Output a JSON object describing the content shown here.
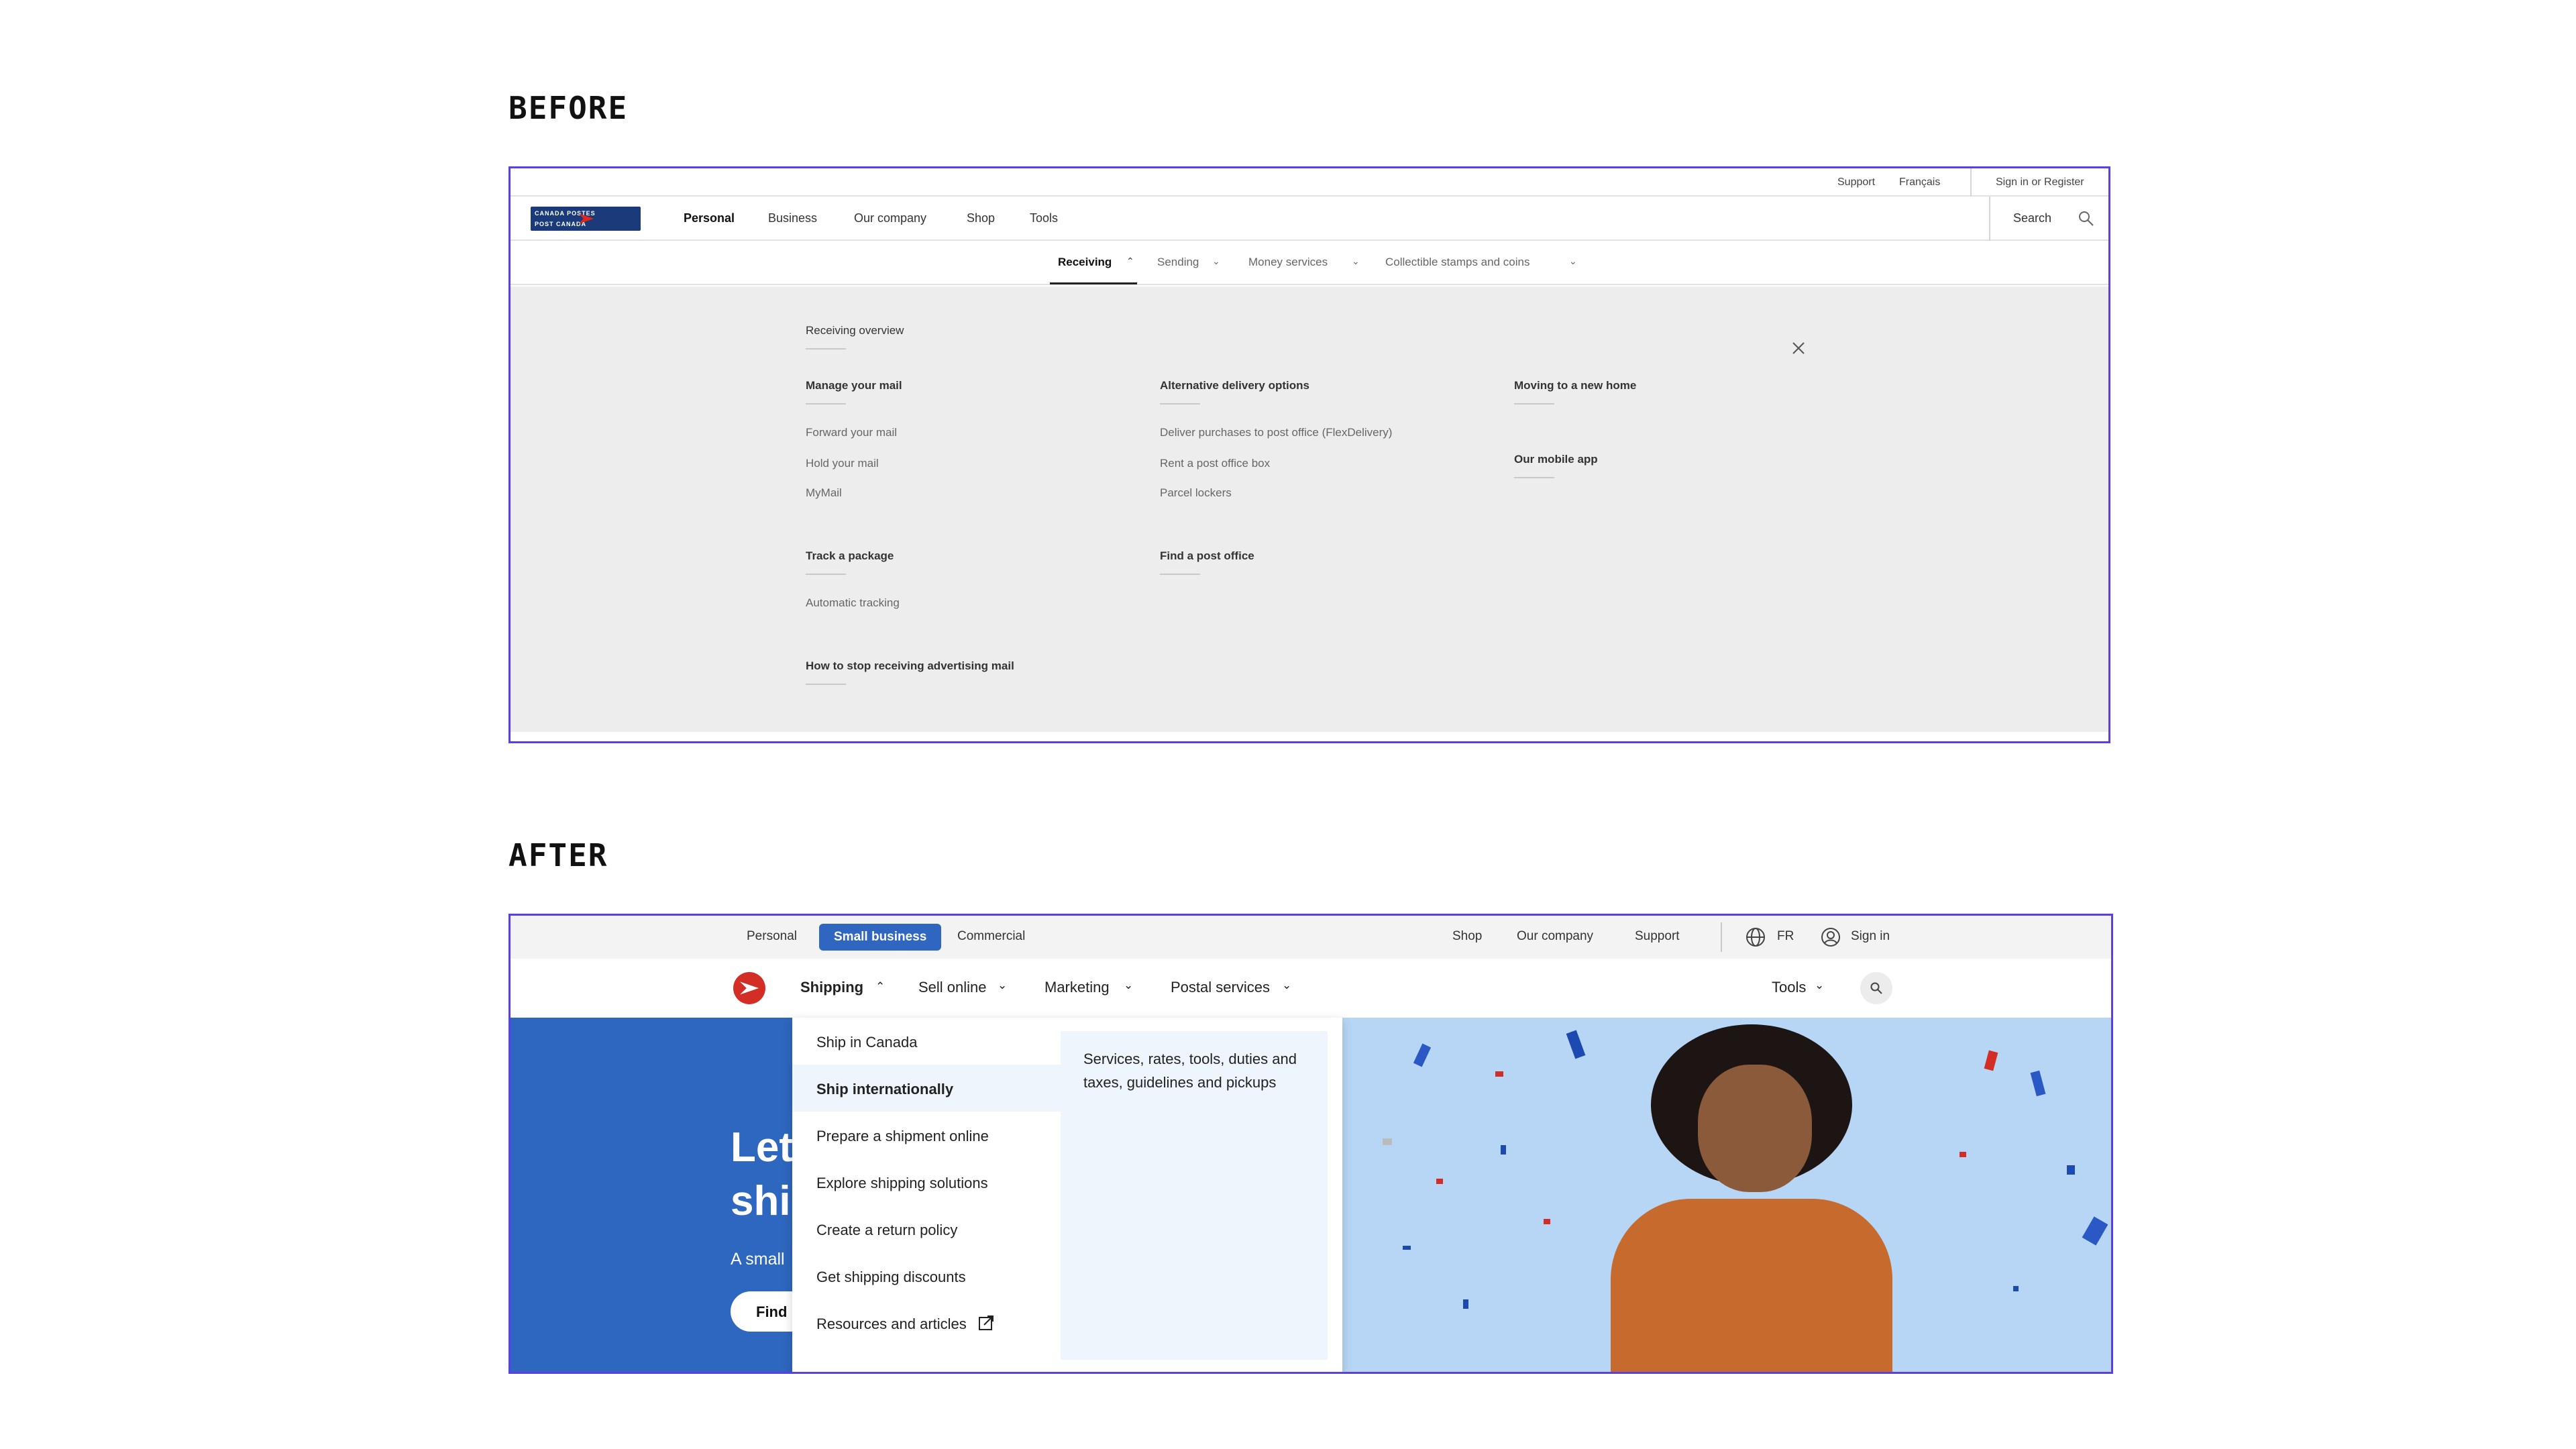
{
  "labels": {
    "before": "BEFORE",
    "after": "AFTER"
  },
  "before": {
    "utility": {
      "support": "Support",
      "language": "Français",
      "sign_in": "Sign in or Register"
    },
    "logo": {
      "line1": "CANADA POSTES",
      "line2": "POST CANADA"
    },
    "main_nav": [
      "Personal",
      "Business",
      "Our company",
      "Shop",
      "Tools"
    ],
    "search_label": "Search",
    "sub_nav": [
      "Receiving",
      "Sending",
      "Money services",
      "Collectible stamps and coins"
    ],
    "mega_menu": {
      "overview": "Receiving overview",
      "col1": {
        "manage_heading": "Manage your mail",
        "manage_links": [
          "Forward your mail",
          "Hold your mail",
          "MyMail"
        ],
        "track_heading": "Track a package",
        "track_links": [
          "Automatic tracking"
        ],
        "stop_heading": "How to stop receiving advertising mail"
      },
      "col2": {
        "alt_heading": "Alternative delivery options",
        "alt_links": [
          "Deliver purchases to post office (FlexDelivery)",
          "Rent a post office box",
          "Parcel lockers"
        ],
        "find_heading": "Find a post office"
      },
      "col3": {
        "moving_heading": "Moving to a new home",
        "app_heading": "Our mobile app"
      }
    }
  },
  "after": {
    "segments": [
      "Personal",
      "Small business",
      "Commercial"
    ],
    "utility_links": [
      "Shop",
      "Our company",
      "Support"
    ],
    "language": "FR",
    "sign_in": "Sign in",
    "main_nav": [
      "Shipping",
      "Sell online",
      "Marketing",
      "Postal services"
    ],
    "tools": "Tools",
    "dropdown_items": [
      "Ship in Canada",
      "Ship internationally",
      "Prepare a shipment online",
      "Explore shipping solutions",
      "Create a return policy",
      "Get shipping discounts",
      "Resources and articles"
    ],
    "dropdown_description": "Services, rates, tools, duties and taxes, guidelines and pickups",
    "hero": {
      "title_line1": "Let",
      "title_line2": "shi",
      "subtitle": "A small",
      "button": "Find"
    },
    "colors": {
      "brand_red": "#d22e25",
      "accent_blue": "#2f66bf",
      "hero_blue": "#2e67bf",
      "hero_sky": "#b7d6f5"
    }
  }
}
